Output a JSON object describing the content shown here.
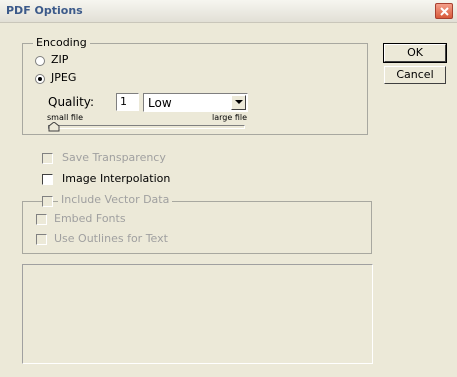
{
  "window": {
    "title": "PDF Options"
  },
  "encoding": {
    "legend": "Encoding",
    "zip_label": "ZIP",
    "jpeg_label": "JPEG",
    "selected": "JPEG",
    "quality_label": "Quality:",
    "quality_value": "1",
    "quality_select": "Low",
    "slider_min_label": "small file",
    "slider_max_label": "large file",
    "slider_fraction": 0.0
  },
  "options": {
    "save_transparency": "Save Transparency",
    "image_interpolation": "Image Interpolation"
  },
  "vector": {
    "include_vector_data": "Include Vector Data",
    "embed_fonts": "Embed Fonts",
    "use_outlines": "Use Outlines for Text"
  },
  "buttons": {
    "ok": "OK",
    "cancel": "Cancel"
  }
}
